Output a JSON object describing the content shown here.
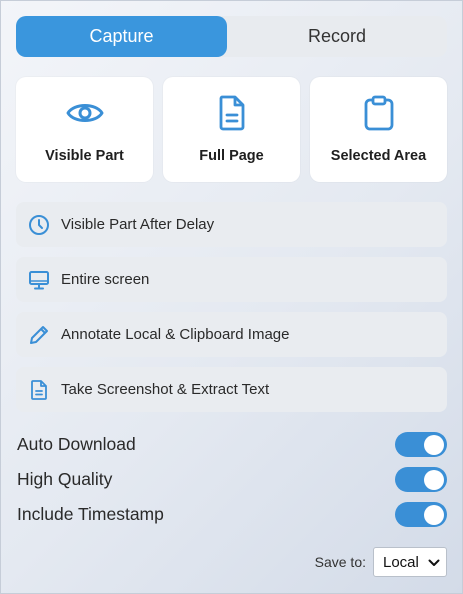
{
  "tabs": [
    {
      "label": "Capture",
      "active": true
    },
    {
      "label": "Record",
      "active": false
    }
  ],
  "cards": [
    {
      "label": "Visible Part",
      "icon": "eye-icon"
    },
    {
      "label": "Full Page",
      "icon": "document-icon"
    },
    {
      "label": "Selected Area",
      "icon": "clipboard-icon"
    }
  ],
  "options": [
    {
      "label": "Visible Part After Delay",
      "icon": "clock-icon"
    },
    {
      "label": "Entire screen",
      "icon": "monitor-icon"
    },
    {
      "label": "Annotate Local & Clipboard Image",
      "icon": "pencil-icon"
    },
    {
      "label": "Take Screenshot & Extract Text",
      "icon": "text-document-icon"
    }
  ],
  "toggles": [
    {
      "label": "Auto Download",
      "on": true
    },
    {
      "label": "High Quality",
      "on": true
    },
    {
      "label": "Include Timestamp",
      "on": true
    }
  ],
  "save": {
    "label": "Save to:",
    "selected": "Local"
  },
  "colors": {
    "accent": "#3a96dd",
    "icon": "#3a8fd6"
  }
}
